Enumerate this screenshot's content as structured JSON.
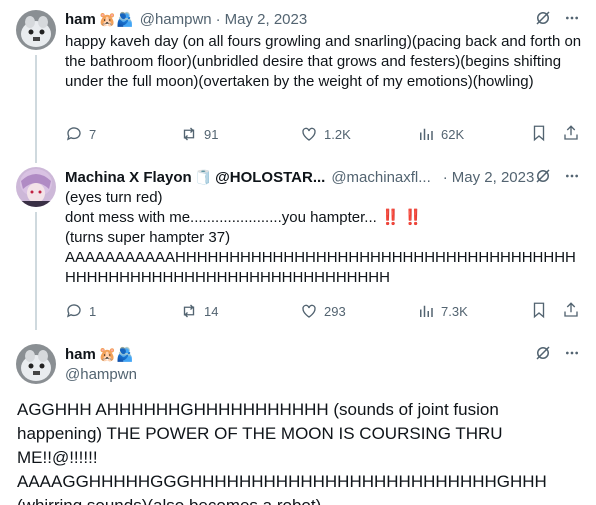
{
  "tweets": [
    {
      "name": "ham",
      "emoji": "🐹🫂",
      "handle": "@hampwn",
      "sep": "·",
      "date": "May 2, 2023",
      "text": "happy kaveh day (on all fours growling and snarling)(pacing back and forth on the bathroom floor)(unbridled desire that grows and festers)(begins shifting under the full moon)(overtaken by the weight of my emotions)(howling)",
      "replies": "7",
      "reposts": "91",
      "likes": "1.2K",
      "views": "62K"
    },
    {
      "name": "Machina X Flayon",
      "emoji": "🧻",
      "name_suffix": "@HOLOSTAR...",
      "handle": "@machinaxfl...",
      "sep": "·",
      "date": "May 2, 2023",
      "line1": "(eyes turn red)",
      "line2": "dont mess with me......................you hampter...",
      "line2_marks": "‼️ ‼️",
      "line3": "(turns super hampter 37)",
      "line4": "AAAAAAAAAAAHHHHHHHHHHHHHHHHHHHHHHHHHHHHHHHHHHHHHHHHHHHHHHHHHHHHHHHHHHHHHHHHHHH",
      "replies": "1",
      "reposts": "14",
      "likes": "293",
      "views": "7.3K"
    },
    {
      "name": "ham",
      "emoji": "🐹🫂",
      "handle": "@hampwn",
      "text": "AGGHHH AHHHHHHGHHHHHHHHHHH (sounds of joint fusion happening) THE POWER OF THE MOON IS COURSING THRU ME!!@!!!!!! AAAAGGHHHHHGGGHHHHHHHHHHHHHHHHHHHHHHHHHGHHH (whirring sounds)(also becomes a robot)"
    }
  ],
  "colors": {
    "text": "#0f1419",
    "secondary": "#536471",
    "thread_line": "#cfd9de",
    "red_marks": "#e0245e"
  },
  "icons": [
    "grok-icon",
    "more-icon",
    "reply-icon",
    "repost-icon",
    "like-icon",
    "views-icon",
    "bookmark-icon",
    "share-icon"
  ]
}
